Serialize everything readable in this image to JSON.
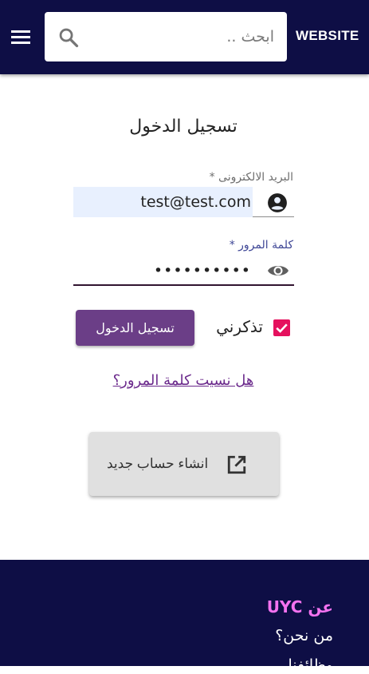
{
  "header": {
    "brand": "WEBSITE",
    "search_placeholder": "ابحث ..",
    "icons": [
      "menu-icon",
      "search-icon"
    ]
  },
  "login": {
    "title": "تسجيل الدخول",
    "email_label": "البريد الالكترونى *",
    "email_value": "test@test.com",
    "password_label": "كلمة المرور *",
    "password_value": "••••••••••",
    "remember_label": "تذكرني",
    "remember_checked": true,
    "login_button": "تسجيل الدخول",
    "forgot_link": "هل نسيت كلمة المرور؟",
    "register_button": "انشاء حساب جديد",
    "icons": [
      "account-circle-icon",
      "eye-icon",
      "checkbox-checked-icon",
      "open-in-new-icon"
    ]
  },
  "footer": {
    "heading": "عن UYC",
    "links": [
      "من نحن؟",
      "وظائفنا"
    ]
  },
  "colors": {
    "header_bg": "#0e0e45",
    "accent_purple": "#6b3e87",
    "checkbox_pink": "#e5115e",
    "footer_heading": "#f472f0"
  }
}
